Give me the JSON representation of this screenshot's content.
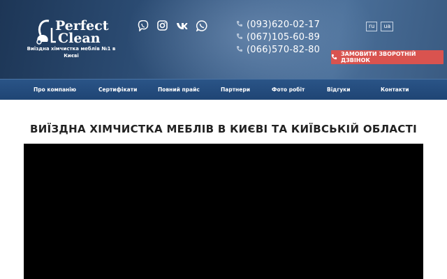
{
  "logo": {
    "title_line1": "Perfect",
    "title_line2": "Clean",
    "subtitle": "Виїздна хімчистка меблів №1 в Києві",
    "icon": "vacuum-cleaner-icon"
  },
  "socials": [
    {
      "name": "viber-icon"
    },
    {
      "name": "instagram-icon"
    },
    {
      "name": "vk-icon"
    },
    {
      "name": "whatsapp-icon"
    }
  ],
  "phones": [
    "(093)620-02-17",
    "(067)105-60-89",
    "(066)570-82-80"
  ],
  "languages": [
    "ru",
    "ua"
  ],
  "callback_button": {
    "label": "ЗАМОВИТИ ЗВОРОТНІЙ ДЗВІНОК",
    "color": "#d9534f"
  },
  "nav": [
    "Про компанію",
    "Сертифікати",
    "Повний прайс",
    "Партнери",
    "Фото робіт",
    "Відгуки",
    "Контакти"
  ],
  "main": {
    "title": "ВИЇЗДНА ХІМЧИСТКА МЕБЛІВ В КИЄВІ ТА КИЇВСЬКІЙ ОБЛАСТІ"
  },
  "colors": {
    "header_bg": "#2b4b72",
    "nav_bg": "#24497a",
    "accent": "#d9534f"
  }
}
